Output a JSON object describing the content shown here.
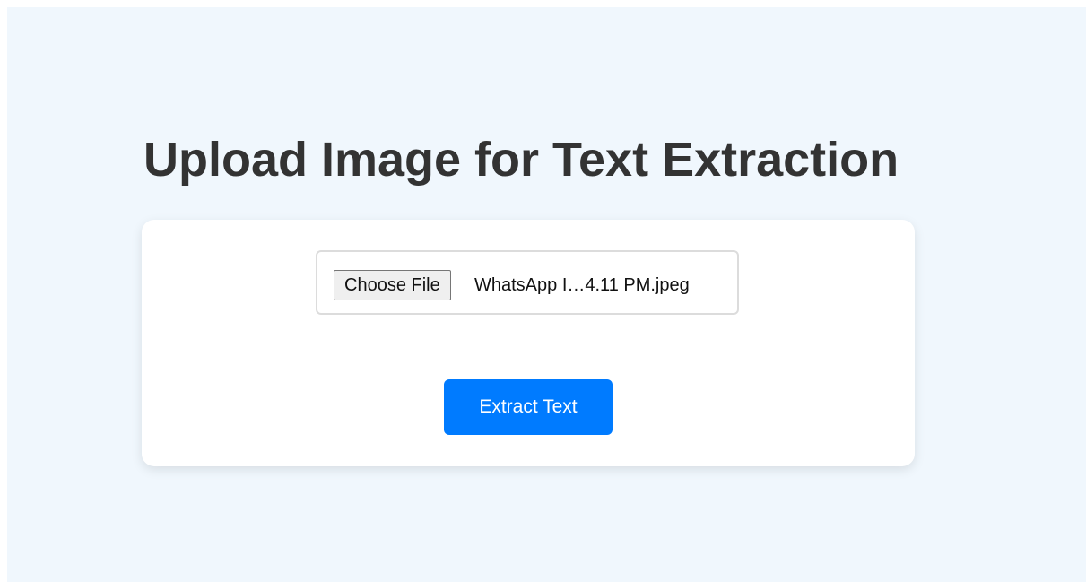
{
  "page": {
    "title": "Upload Image for Text Extraction"
  },
  "upload_form": {
    "choose_file_label": "Choose File",
    "selected_file_name": "WhatsApp I…4.11 PM.jpeg",
    "submit_label": "Extract Text"
  },
  "colors": {
    "background": "#f0f7fd",
    "card": "#ffffff",
    "title_text": "#333333",
    "primary_button": "#007bff",
    "primary_button_text": "#ffffff"
  }
}
